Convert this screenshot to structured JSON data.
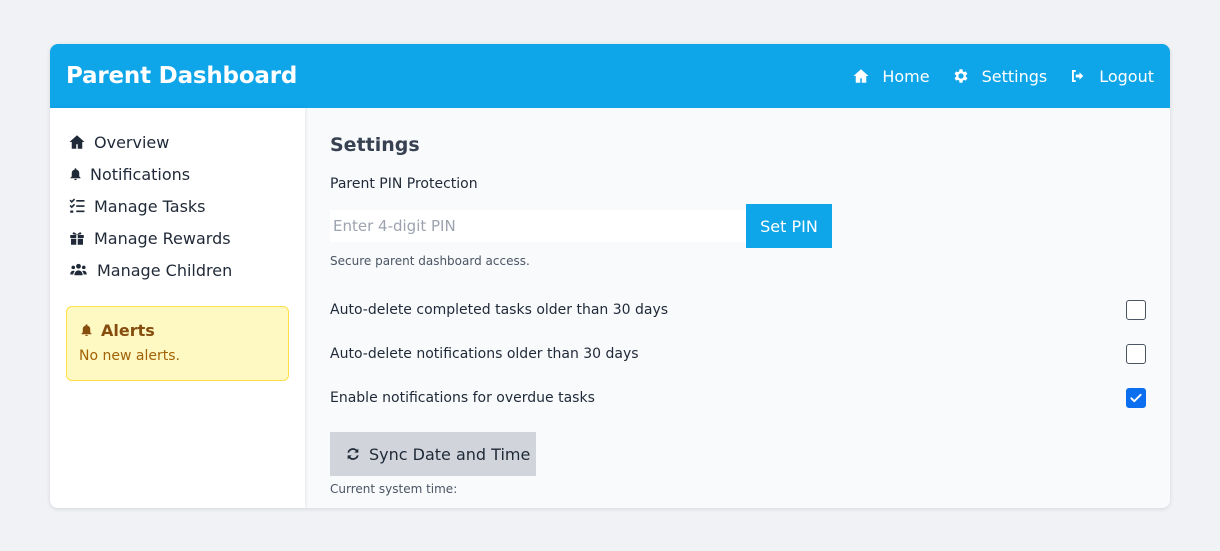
{
  "header": {
    "title": "Parent Dashboard",
    "nav": [
      {
        "label": "Home",
        "icon": "home-icon"
      },
      {
        "label": "Settings",
        "icon": "gear-icon"
      },
      {
        "label": "Logout",
        "icon": "logout-icon"
      }
    ]
  },
  "sidebar": {
    "items": [
      {
        "label": "Overview",
        "icon": "home-icon"
      },
      {
        "label": "Notifications",
        "icon": "bell-icon"
      },
      {
        "label": "Manage Tasks",
        "icon": "task-list-icon"
      },
      {
        "label": "Manage Rewards",
        "icon": "gift-icon"
      },
      {
        "label": "Manage Children",
        "icon": "users-icon"
      }
    ],
    "alerts": {
      "title": "Alerts",
      "text": "No new alerts."
    }
  },
  "settings": {
    "title": "Settings",
    "pin": {
      "label": "Parent PIN Protection",
      "placeholder": "Enter 4-digit PIN",
      "button": "Set PIN",
      "help": "Secure parent dashboard access."
    },
    "options": [
      {
        "label": "Auto-delete completed tasks older than 30 days",
        "checked": false
      },
      {
        "label": "Auto-delete notifications older than 30 days",
        "checked": false
      },
      {
        "label": "Enable notifications for overdue tasks",
        "checked": true
      }
    ],
    "sync": {
      "button": "Sync Date and Time",
      "system_time_label": "Current system time:"
    }
  },
  "colors": {
    "header_bg": "#0ea5e9",
    "alert_bg": "#fef9c3",
    "checkbox_checked": "#0b6ff0"
  }
}
